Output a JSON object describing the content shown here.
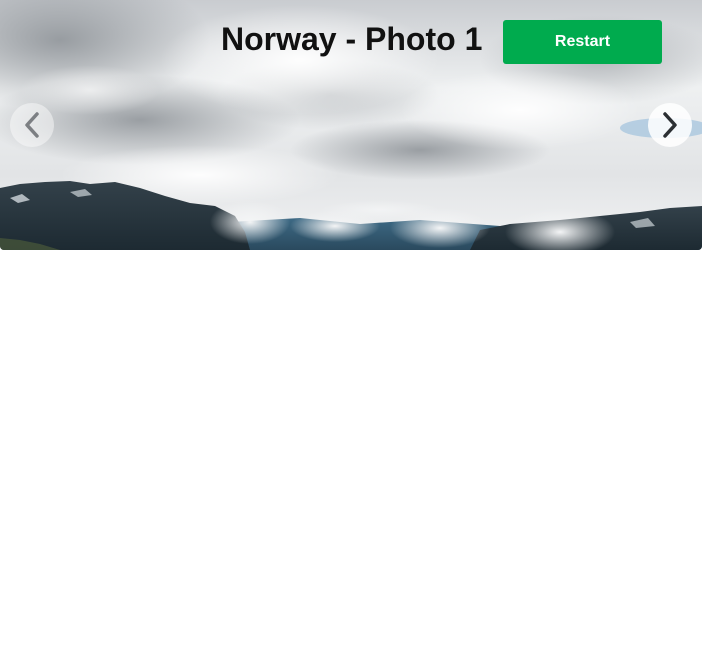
{
  "slide": {
    "title": "Norway - Photo 1",
    "image_subject": "cloudy sky over snow-dusted mountain ridge with low clouds in fjord valleys"
  },
  "controls": {
    "restart_label": "Restart",
    "prev_icon": "chevron-left-icon",
    "next_icon": "chevron-right-icon"
  },
  "colors": {
    "restart_bg": "#00AB4E"
  }
}
